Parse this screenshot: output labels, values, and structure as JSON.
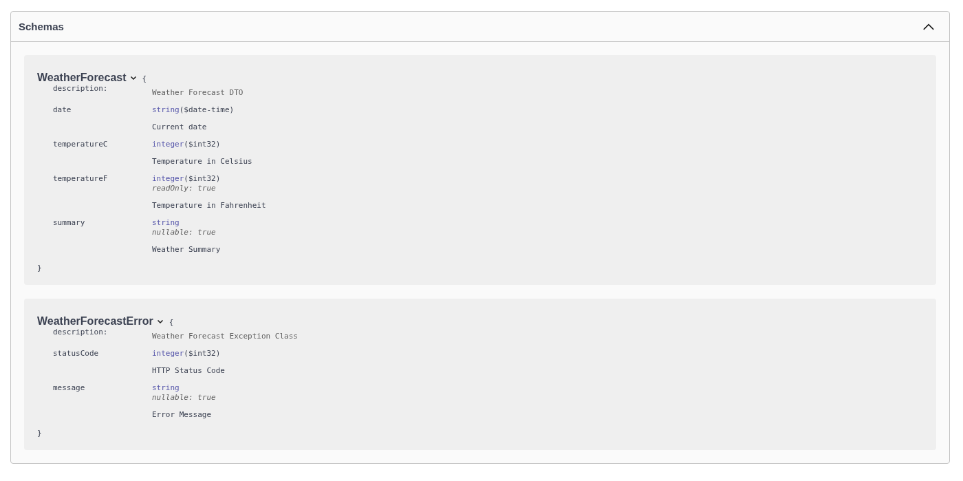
{
  "section": {
    "title": "Schemas",
    "expanded": true
  },
  "models": [
    {
      "name": "WeatherForecast",
      "expanded": true,
      "open_brace": "{",
      "close_brace": "}",
      "description_label": "description:",
      "description": "Weather Forecast DTO",
      "properties": [
        {
          "name": "date",
          "type": "string",
          "format": "($date-time)",
          "description": "Current date"
        },
        {
          "name": "temperatureC",
          "type": "integer",
          "format": "($int32)",
          "description": "Temperature in Celsius"
        },
        {
          "name": "temperatureF",
          "type": "integer",
          "format": "($int32)",
          "note": "readOnly: true",
          "description": "Temperature in Fahrenheit"
        },
        {
          "name": "summary",
          "type": "string",
          "note": "nullable: true",
          "description": "Weather Summary"
        }
      ]
    },
    {
      "name": "WeatherForecastError",
      "expanded": true,
      "open_brace": "{",
      "close_brace": "}",
      "description_label": "description:",
      "description": "Weather Forecast Exception Class",
      "properties": [
        {
          "name": "statusCode",
          "type": "integer",
          "format": "($int32)",
          "description": "HTTP Status Code"
        },
        {
          "name": "message",
          "type": "string",
          "note": "nullable: true",
          "description": "Error Message"
        }
      ]
    }
  ]
}
